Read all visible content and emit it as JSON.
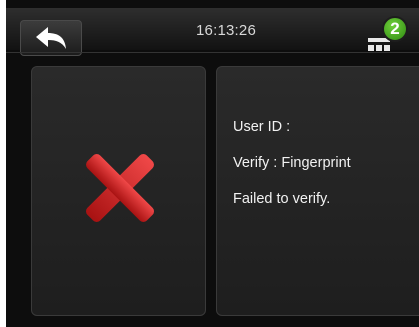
{
  "topbar": {
    "back_icon": "back-arrow-icon",
    "time": "16:13:26",
    "pending_icon": "pending-records-icon",
    "pending_count": "2"
  },
  "result": {
    "status_icon": "red-x-icon",
    "user_id": "User ID :",
    "verify": "Verify : Fingerprint",
    "message": "Failed to verify."
  },
  "colors": {
    "accent_red": "#d42020",
    "badge_green": "#4caf2a"
  }
}
